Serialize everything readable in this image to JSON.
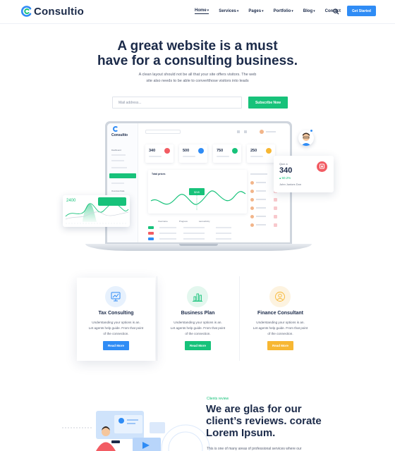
{
  "header": {
    "logo_text": "Consultio",
    "nav": [
      {
        "label": "Home",
        "dropdown": true,
        "active": true
      },
      {
        "label": "Services",
        "dropdown": true
      },
      {
        "label": "Pages",
        "dropdown": true
      },
      {
        "label": "Portfolio",
        "dropdown": true
      },
      {
        "label": "Blog",
        "dropdown": true
      },
      {
        "label": "Contact",
        "dropdown": false
      }
    ],
    "search_icon": "search-icon",
    "cta_label": "Get Started"
  },
  "hero": {
    "title_line1": "A great website is a must",
    "title_line2": "have for a consulting business.",
    "subtitle_line1": "A clean layout should not be all that your site offers visitors. The web",
    "subtitle_line2": "site also needs to be able to convertthose visitors into leads",
    "email_placeholder": "Mail address...",
    "subscribe_label": "Subscribe Now"
  },
  "dashboard_mockup": {
    "logo_text": "Consultio",
    "menu": [
      "Dashboard",
      "",
      "",
      "",
      "",
      "",
      "Overview Data"
    ],
    "stats": [
      "340",
      "500",
      "750",
      "250"
    ],
    "chart_title": "Total prices",
    "chart_tooltip": "$245",
    "table_headers": [
      "Username",
      "Progress",
      "Last activity"
    ],
    "float_left_value": "2400",
    "float_right": {
      "label": "Quiz a",
      "value": "340",
      "change": "50.2%",
      "name": "John Juniors Don"
    }
  },
  "services": [
    {
      "title": "Tax Consulting",
      "text_line1": "Understanding your options is an.",
      "text_line2": "Let agents help guide. From that point",
      "text_line3": "of the connection.",
      "button": "Read More",
      "icon": "chart-monitor-icon",
      "active": true
    },
    {
      "title": "Business Plan",
      "text_line1": "Understanding your options is an.",
      "text_line2": "Let agents help guide. From that point",
      "text_line3": "of the connection.",
      "button": "Read More",
      "icon": "bar-chart-icon",
      "active": false
    },
    {
      "title": "Finance Consultant",
      "text_line1": "Understanding your options is an.",
      "text_line2": "Let agents help guide. From that point",
      "text_line3": "of the connection.",
      "button": "Read More",
      "icon": "user-circle-icon",
      "active": false
    }
  ],
  "reviews": {
    "tag": "Clients review",
    "title_line1": "We are glas for our",
    "title_line2": "client’s reviews. corate",
    "title_line3": "Lorem Ipsum.",
    "text": "This is one of many areas of professional services where our"
  },
  "colors": {
    "brand_blue": "#2f8cf5",
    "brand_green": "#17c27a",
    "brand_orange": "#f7b733",
    "navy": "#1b2a49"
  }
}
